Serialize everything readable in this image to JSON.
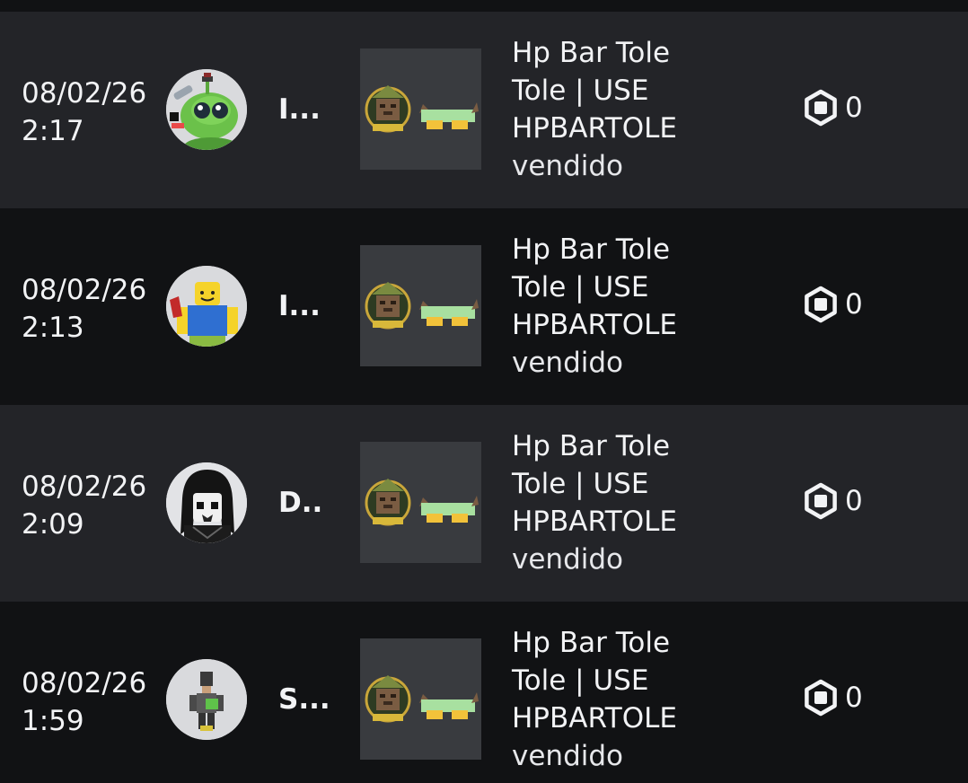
{
  "rows": [
    {
      "date": "08/02/26",
      "time": "2:17",
      "username": "I...",
      "avatar_icon": "green-alien-avatar-icon",
      "item_name": "Hp Bar Tole Tole | USE HPBARTOLE",
      "status": "vendido",
      "price": "0",
      "price_icon": "robux-icon"
    },
    {
      "date": "08/02/26",
      "time": "2:13",
      "username": "I...",
      "avatar_icon": "classic-noob-avatar-icon",
      "item_name": "Hp Bar Tole Tole | USE HPBARTOLE",
      "status": "vendido",
      "price": "0",
      "price_icon": "robux-icon"
    },
    {
      "date": "08/02/26",
      "time": "2:09",
      "username": "D..",
      "avatar_icon": "dark-hair-avatar-icon",
      "item_name": "Hp Bar Tole Tole | USE HPBARTOLE",
      "status": "vendido",
      "price": "0",
      "price_icon": "robux-icon"
    },
    {
      "date": "08/02/26",
      "time": "1:59",
      "username": "S...",
      "avatar_icon": "small-figure-avatar-icon",
      "item_name": "Hp Bar Tole Tole | USE HPBARTOLE",
      "status": "vendido",
      "price": "0",
      "price_icon": "robux-icon"
    }
  ],
  "colors": {
    "row_light": "#232428",
    "row_dark": "#111214",
    "text": "#f2f3f5",
    "thumb_bg": "#393b3f"
  }
}
